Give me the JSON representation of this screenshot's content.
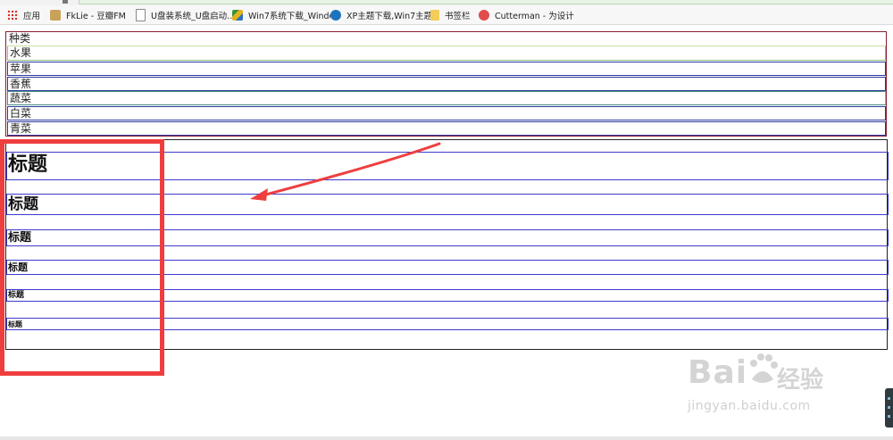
{
  "bookmarks": {
    "items": [
      {
        "label": "应用",
        "icon": "apps-grid-icon"
      },
      {
        "label": "FkLie - 豆瓣FM",
        "icon": "fm-icon"
      },
      {
        "label": "U盘装系统_U盘启动…",
        "icon": "page-icon"
      },
      {
        "label": "Win7系统下载_Windo",
        "icon": "cube-icon"
      },
      {
        "label": "XP主题下载,Win7主题",
        "icon": "q-icon"
      },
      {
        "label": "书签栏",
        "icon": "folder-icon"
      },
      {
        "label": "Cutterman - 为设计",
        "icon": "cutterman-icon"
      }
    ]
  },
  "table": {
    "rows": [
      "种类",
      "水果",
      "苹果",
      "香蕉",
      "蔬菜",
      "白菜",
      "青菜"
    ]
  },
  "headings": {
    "h1": "标题",
    "h2": "标题",
    "h3": "标题",
    "h4": "标题",
    "h5": "标题",
    "h6": "标题"
  },
  "watermark": {
    "brand": "Bai",
    "brand_tail": "经验",
    "url": "jingyan.baidu.com"
  },
  "colors": {
    "annotation_red": "#ef3e3e",
    "heading_border": "#3b3bcc",
    "table_border": "#8a1c2c"
  }
}
